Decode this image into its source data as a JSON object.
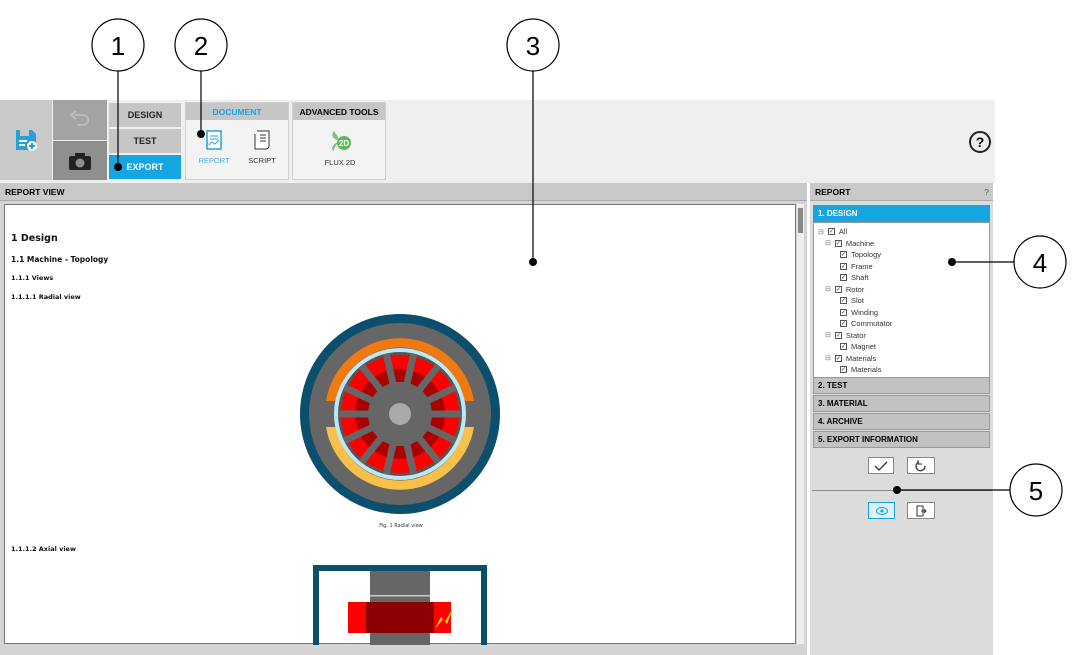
{
  "toolbar": {
    "modes": [
      "DESIGN",
      "TEST",
      "EXPORT"
    ],
    "document_group": "DOCUMENT",
    "report": "REPORT",
    "script": "SCRIPT",
    "advanced_group": "ADVANCED TOOLS",
    "flux2d": "FLUX 2D",
    "flux_badge": "2D",
    "help": "?"
  },
  "report_view": {
    "title": "REPORT VIEW",
    "h1": "1 Design",
    "h2": "1.1 Machine - Topology",
    "h3": "1.1.1 Views",
    "h4": "1.1.1.1 Radial view",
    "fig1": "Fig. 1 Radial view",
    "h4b": "1.1.1.2 Axial view"
  },
  "report_panel": {
    "title": "REPORT",
    "help": "?",
    "active_section": "1. DESIGN",
    "tree": [
      "All",
      "Machine",
      "Topology",
      "Frame",
      "Shaft",
      "Rotor",
      "Slot",
      "Winding",
      "Commutator",
      "Stator",
      "Magnet",
      "Materials",
      "Materials"
    ],
    "sections": [
      "2. TEST",
      "3. MATERIAL",
      "4. ARCHIVE",
      "5. EXPORT INFORMATION"
    ]
  },
  "callouts": [
    "1",
    "2",
    "3",
    "4",
    "5"
  ],
  "colors": {
    "accent": "#15a6e1",
    "frame": "#0b4f6c"
  }
}
